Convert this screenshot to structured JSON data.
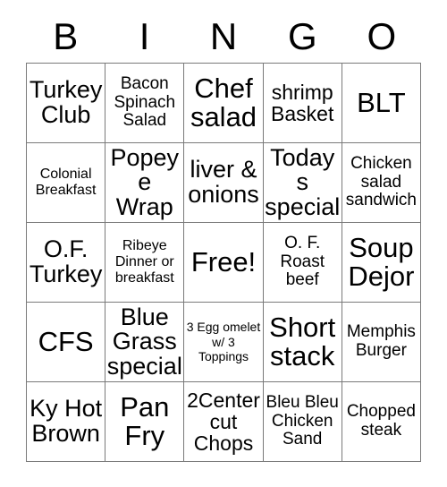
{
  "card": {
    "title": "BINGO",
    "header_letters": [
      "B",
      "I",
      "N",
      "G",
      "O"
    ],
    "border_color": "#7a7a7a",
    "text_color": "#000000",
    "background_color": "#ffffff",
    "columns": 5,
    "rows": 5,
    "free_space": {
      "row": 3,
      "column": 3,
      "label": "Free!"
    },
    "cells": [
      {
        "text": "Turkey Club",
        "size": "xl"
      },
      {
        "text": "Bacon Spinach Salad",
        "size": "md"
      },
      {
        "text": "Chef salad",
        "size": "xxl"
      },
      {
        "text": "shrimp Basket",
        "size": "lg"
      },
      {
        "text": "BLT",
        "size": "xxl"
      },
      {
        "text": "Colonial Breakfast",
        "size": "sm"
      },
      {
        "text": "Popeye Wrap",
        "size": "xl"
      },
      {
        "text": "liver & onions",
        "size": "xl"
      },
      {
        "text": "Todays special",
        "size": "xl"
      },
      {
        "text": "Chicken salad sandwich",
        "size": "md"
      },
      {
        "text": "O.F. Turkey",
        "size": "xl"
      },
      {
        "text": "Ribeye Dinner or breakfast",
        "size": "sm"
      },
      {
        "text": "Free!",
        "size": "xxl"
      },
      {
        "text": "O. F. Roast beef",
        "size": "md"
      },
      {
        "text": "Soup Dejor",
        "size": "xxl"
      },
      {
        "text": "CFS",
        "size": "xxl"
      },
      {
        "text": "Blue Grass special",
        "size": "xl"
      },
      {
        "text": "3 Egg omelet w/ 3 Toppings",
        "size": "xs"
      },
      {
        "text": "Short stack",
        "size": "xxl"
      },
      {
        "text": "Memphis Burger",
        "size": "md"
      },
      {
        "text": "Ky Hot Brown",
        "size": "xl"
      },
      {
        "text": "Pan Fry",
        "size": "xxl"
      },
      {
        "text": "2Center cut Chops",
        "size": "lg"
      },
      {
        "text": "Bleu Bleu Chicken Sand",
        "size": "md"
      },
      {
        "text": "Chopped steak",
        "size": "md"
      }
    ]
  }
}
